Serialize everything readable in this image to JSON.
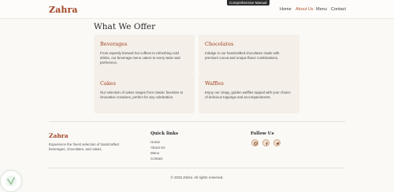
{
  "header": {
    "brand": "Zahra",
    "tooltip": "Comprehensive Manual",
    "nav": [
      {
        "label": "Home",
        "active": false
      },
      {
        "label": "About Us",
        "active": true
      },
      {
        "label": "Menu",
        "active": false
      },
      {
        "label": "Contact",
        "active": false
      }
    ]
  },
  "offer": {
    "title": "What We Offer",
    "cards": [
      {
        "title": "Beverages",
        "text": "From expertly brewed hot coffees to refreshing cold drinks, our beverage menu caters to every taste and preference."
      },
      {
        "title": "Chocolates",
        "text": "Indulge in our handcrafted chocolates made with premium cocoa and unique flavor combinations."
      },
      {
        "title": "Cakes",
        "text": "Our selection of cakes ranges from classic favorites to innovative creations, perfect for any celebration."
      },
      {
        "title": "Waffles",
        "text": "Enjoy our crispy, golden waffles topped with your choice of delicious toppings and accompaniments."
      }
    ]
  },
  "footer": {
    "brand": "Zahra",
    "description": "Experience the finest selection of handcrafted beverages, chocolates, and cakes.",
    "quick_links_title": "Quick links",
    "links": [
      "Home",
      "About Us",
      "Menu",
      "Contact"
    ],
    "follow_title": "Follow Us",
    "social_icons": [
      "instagram-icon",
      "facebook-icon",
      "twitter-icon"
    ],
    "copyright": "© 2025 Zahra. All rights reserved."
  },
  "colors": {
    "accent": "#a14424",
    "card_bg": "#f4efe8",
    "page_bg": "#fbf9f6"
  }
}
